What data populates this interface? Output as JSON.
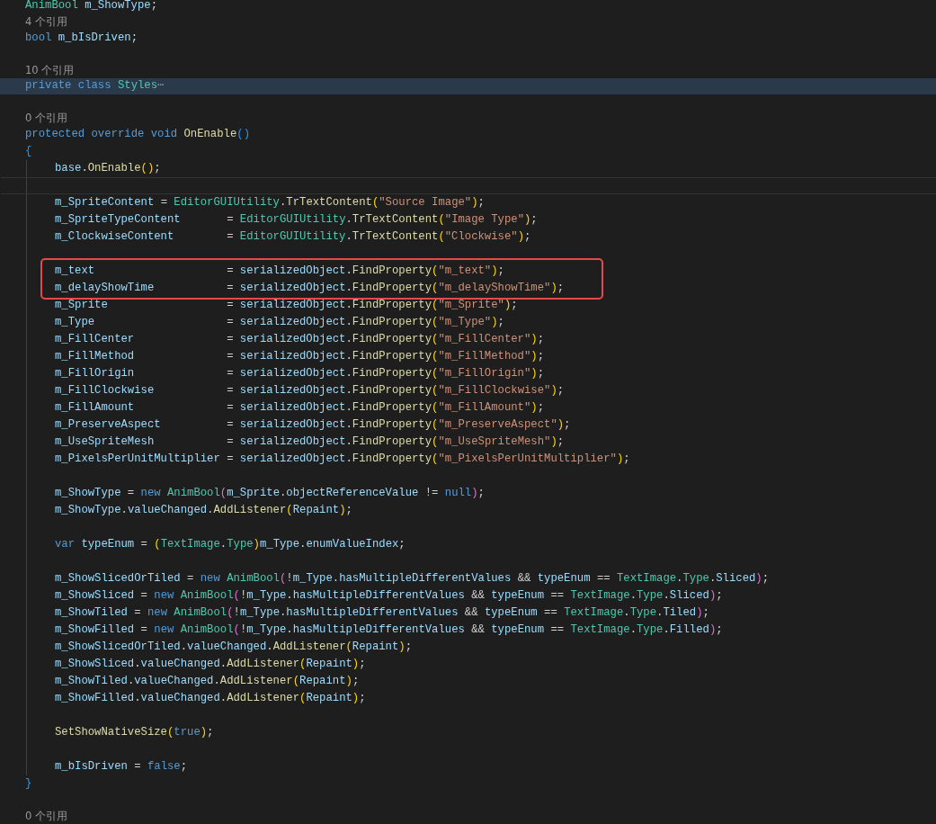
{
  "lines": [
    {
      "kind": "code",
      "selected": false,
      "tokens": [
        {
          "kind": "type",
          "text": "AnimBool"
        },
        {
          "kind": "var",
          "text": " m_ShowType"
        },
        {
          "kind": "op",
          "text": ";"
        }
      ]
    },
    {
      "kind": "lens",
      "selected": false,
      "text": "4 个引用"
    },
    {
      "kind": "code",
      "selected": false,
      "tokens": [
        {
          "kind": "kw",
          "text": "bool"
        },
        {
          "kind": "var",
          "text": " m_bIsDriven"
        },
        {
          "kind": "op",
          "text": ";"
        }
      ]
    },
    {
      "kind": "blank",
      "selected": false
    },
    {
      "kind": "lens",
      "selected": false,
      "text": "10 个引用"
    },
    {
      "kind": "code",
      "selected": true,
      "tokens": [
        {
          "kind": "kw",
          "text": "private"
        },
        {
          "kind": "kw",
          "text": " class"
        },
        {
          "kind": "type",
          "text": " Styles"
        },
        {
          "kind": "fold",
          "text": "⋯"
        }
      ]
    },
    {
      "kind": "blank",
      "selected": false
    },
    {
      "kind": "lens",
      "selected": false,
      "text": "0 个引用"
    },
    {
      "kind": "code",
      "selected": false,
      "tokens": [
        {
          "kind": "kw",
          "text": "protected"
        },
        {
          "kind": "kw",
          "text": " override"
        },
        {
          "kind": "kw",
          "text": " void"
        },
        {
          "kind": "fn",
          "text": " OnEnable"
        },
        {
          "kind": "p3",
          "text": "()"
        }
      ]
    },
    {
      "kind": "block",
      "selected": false,
      "open": [
        {
          "kind": "p3",
          "text": "{"
        }
      ],
      "close": [
        {
          "kind": "p3",
          "text": "}"
        }
      ],
      "children": [
        {
          "kind": "code",
          "tokens": [
            {
              "kind": "var",
              "text": "base"
            },
            {
              "kind": "op",
              "text": "."
            },
            {
              "kind": "fn",
              "text": "OnEnable"
            },
            {
              "kind": "p1",
              "text": "()"
            },
            {
              "kind": "op",
              "text": ";"
            }
          ]
        },
        {
          "kind": "cursor"
        },
        {
          "kind": "code",
          "tokens": [
            {
              "kind": "var",
              "text": "m_SpriteContent"
            },
            {
              "kind": "op",
              "text": " = "
            },
            {
              "kind": "type",
              "text": "EditorGUIUtility"
            },
            {
              "kind": "op",
              "text": "."
            },
            {
              "kind": "fn",
              "text": "TrTextContent"
            },
            {
              "kind": "p1",
              "text": "("
            },
            {
              "kind": "str",
              "text": "\"Source Image\""
            },
            {
              "kind": "p1",
              "text": ")"
            },
            {
              "kind": "op",
              "text": ";"
            }
          ]
        },
        {
          "kind": "code",
          "tokens": [
            {
              "kind": "var",
              "text": "m_SpriteTypeContent"
            },
            {
              "kind": "op",
              "text": "       = "
            },
            {
              "kind": "type",
              "text": "EditorGUIUtility"
            },
            {
              "kind": "op",
              "text": "."
            },
            {
              "kind": "fn",
              "text": "TrTextContent"
            },
            {
              "kind": "p1",
              "text": "("
            },
            {
              "kind": "str",
              "text": "\"Image Type\""
            },
            {
              "kind": "p1",
              "text": ")"
            },
            {
              "kind": "op",
              "text": ";"
            }
          ]
        },
        {
          "kind": "code",
          "tokens": [
            {
              "kind": "var",
              "text": "m_ClockwiseContent"
            },
            {
              "kind": "op",
              "text": "        = "
            },
            {
              "kind": "type",
              "text": "EditorGUIUtility"
            },
            {
              "kind": "op",
              "text": "."
            },
            {
              "kind": "fn",
              "text": "TrTextContent"
            },
            {
              "kind": "p1",
              "text": "("
            },
            {
              "kind": "str",
              "text": "\"Clockwise\""
            },
            {
              "kind": "p1",
              "text": ")"
            },
            {
              "kind": "op",
              "text": ";"
            }
          ]
        },
        {
          "kind": "blank"
        },
        {
          "kind": "boxed",
          "children": [
            {
              "kind": "code",
              "tokens": [
                {
                  "kind": "var",
                  "text": "m_text"
                },
                {
                  "kind": "op",
                  "text": "                    = "
                },
                {
                  "kind": "var",
                  "text": "serializedObject"
                },
                {
                  "kind": "op",
                  "text": "."
                },
                {
                  "kind": "fn",
                  "text": "FindProperty"
                },
                {
                  "kind": "p1",
                  "text": "("
                },
                {
                  "kind": "str",
                  "text": "\"m_text\""
                },
                {
                  "kind": "p1",
                  "text": ")"
                },
                {
                  "kind": "op",
                  "text": ";"
                }
              ]
            },
            {
              "kind": "code",
              "tokens": [
                {
                  "kind": "var",
                  "text": "m_delayShowTime"
                },
                {
                  "kind": "op",
                  "text": "           = "
                },
                {
                  "kind": "var",
                  "text": "serializedObject"
                },
                {
                  "kind": "op",
                  "text": "."
                },
                {
                  "kind": "fn",
                  "text": "FindProperty"
                },
                {
                  "kind": "p1",
                  "text": "("
                },
                {
                  "kind": "str",
                  "text": "\"m_delayShowTime\""
                },
                {
                  "kind": "p1",
                  "text": ")"
                },
                {
                  "kind": "op",
                  "text": ";"
                }
              ]
            }
          ]
        },
        {
          "kind": "code",
          "tokens": [
            {
              "kind": "var",
              "text": "m_Sprite"
            },
            {
              "kind": "op",
              "text": "                  = "
            },
            {
              "kind": "var",
              "text": "serializedObject"
            },
            {
              "kind": "op",
              "text": "."
            },
            {
              "kind": "fn",
              "text": "FindProperty"
            },
            {
              "kind": "p1",
              "text": "("
            },
            {
              "kind": "str",
              "text": "\"m_Sprite\""
            },
            {
              "kind": "p1",
              "text": ")"
            },
            {
              "kind": "op",
              "text": ";"
            }
          ]
        },
        {
          "kind": "code",
          "tokens": [
            {
              "kind": "var",
              "text": "m_Type"
            },
            {
              "kind": "op",
              "text": "                    = "
            },
            {
              "kind": "var",
              "text": "serializedObject"
            },
            {
              "kind": "op",
              "text": "."
            },
            {
              "kind": "fn",
              "text": "FindProperty"
            },
            {
              "kind": "p1",
              "text": "("
            },
            {
              "kind": "str",
              "text": "\"m_Type\""
            },
            {
              "kind": "p1",
              "text": ")"
            },
            {
              "kind": "op",
              "text": ";"
            }
          ]
        },
        {
          "kind": "code",
          "tokens": [
            {
              "kind": "var",
              "text": "m_FillCenter"
            },
            {
              "kind": "op",
              "text": "              = "
            },
            {
              "kind": "var",
              "text": "serializedObject"
            },
            {
              "kind": "op",
              "text": "."
            },
            {
              "kind": "fn",
              "text": "FindProperty"
            },
            {
              "kind": "p1",
              "text": "("
            },
            {
              "kind": "str",
              "text": "\"m_FillCenter\""
            },
            {
              "kind": "p1",
              "text": ")"
            },
            {
              "kind": "op",
              "text": ";"
            }
          ]
        },
        {
          "kind": "code",
          "tokens": [
            {
              "kind": "var",
              "text": "m_FillMethod"
            },
            {
              "kind": "op",
              "text": "              = "
            },
            {
              "kind": "var",
              "text": "serializedObject"
            },
            {
              "kind": "op",
              "text": "."
            },
            {
              "kind": "fn",
              "text": "FindProperty"
            },
            {
              "kind": "p1",
              "text": "("
            },
            {
              "kind": "str",
              "text": "\"m_FillMethod\""
            },
            {
              "kind": "p1",
              "text": ")"
            },
            {
              "kind": "op",
              "text": ";"
            }
          ]
        },
        {
          "kind": "code",
          "tokens": [
            {
              "kind": "var",
              "text": "m_FillOrigin"
            },
            {
              "kind": "op",
              "text": "              = "
            },
            {
              "kind": "var",
              "text": "serializedObject"
            },
            {
              "kind": "op",
              "text": "."
            },
            {
              "kind": "fn",
              "text": "FindProperty"
            },
            {
              "kind": "p1",
              "text": "("
            },
            {
              "kind": "str",
              "text": "\"m_FillOrigin\""
            },
            {
              "kind": "p1",
              "text": ")"
            },
            {
              "kind": "op",
              "text": ";"
            }
          ]
        },
        {
          "kind": "code",
          "tokens": [
            {
              "kind": "var",
              "text": "m_FillClockwise"
            },
            {
              "kind": "op",
              "text": "           = "
            },
            {
              "kind": "var",
              "text": "serializedObject"
            },
            {
              "kind": "op",
              "text": "."
            },
            {
              "kind": "fn",
              "text": "FindProperty"
            },
            {
              "kind": "p1",
              "text": "("
            },
            {
              "kind": "str",
              "text": "\"m_FillClockwise\""
            },
            {
              "kind": "p1",
              "text": ")"
            },
            {
              "kind": "op",
              "text": ";"
            }
          ]
        },
        {
          "kind": "code",
          "tokens": [
            {
              "kind": "var",
              "text": "m_FillAmount"
            },
            {
              "kind": "op",
              "text": "              = "
            },
            {
              "kind": "var",
              "text": "serializedObject"
            },
            {
              "kind": "op",
              "text": "."
            },
            {
              "kind": "fn",
              "text": "FindProperty"
            },
            {
              "kind": "p1",
              "text": "("
            },
            {
              "kind": "str",
              "text": "\"m_FillAmount\""
            },
            {
              "kind": "p1",
              "text": ")"
            },
            {
              "kind": "op",
              "text": ";"
            }
          ]
        },
        {
          "kind": "code",
          "tokens": [
            {
              "kind": "var",
              "text": "m_PreserveAspect"
            },
            {
              "kind": "op",
              "text": "          = "
            },
            {
              "kind": "var",
              "text": "serializedObject"
            },
            {
              "kind": "op",
              "text": "."
            },
            {
              "kind": "fn",
              "text": "FindProperty"
            },
            {
              "kind": "p1",
              "text": "("
            },
            {
              "kind": "str",
              "text": "\"m_PreserveAspect\""
            },
            {
              "kind": "p1",
              "text": ")"
            },
            {
              "kind": "op",
              "text": ";"
            }
          ]
        },
        {
          "kind": "code",
          "tokens": [
            {
              "kind": "var",
              "text": "m_UseSpriteMesh"
            },
            {
              "kind": "op",
              "text": "           = "
            },
            {
              "kind": "var",
              "text": "serializedObject"
            },
            {
              "kind": "op",
              "text": "."
            },
            {
              "kind": "fn",
              "text": "FindProperty"
            },
            {
              "kind": "p1",
              "text": "("
            },
            {
              "kind": "str",
              "text": "\"m_UseSpriteMesh\""
            },
            {
              "kind": "p1",
              "text": ")"
            },
            {
              "kind": "op",
              "text": ";"
            }
          ]
        },
        {
          "kind": "code",
          "tokens": [
            {
              "kind": "var",
              "text": "m_PixelsPerUnitMultiplier"
            },
            {
              "kind": "op",
              "text": " = "
            },
            {
              "kind": "var",
              "text": "serializedObject"
            },
            {
              "kind": "op",
              "text": "."
            },
            {
              "kind": "fn",
              "text": "FindProperty"
            },
            {
              "kind": "p1",
              "text": "("
            },
            {
              "kind": "str",
              "text": "\"m_PixelsPerUnitMultiplier\""
            },
            {
              "kind": "p1",
              "text": ")"
            },
            {
              "kind": "op",
              "text": ";"
            }
          ]
        },
        {
          "kind": "blank"
        },
        {
          "kind": "code",
          "tokens": [
            {
              "kind": "var",
              "text": "m_ShowType"
            },
            {
              "kind": "op",
              "text": " = "
            },
            {
              "kind": "kw",
              "text": "new"
            },
            {
              "kind": "type",
              "text": " AnimBool"
            },
            {
              "kind": "p2",
              "text": "("
            },
            {
              "kind": "var",
              "text": "m_Sprite"
            },
            {
              "kind": "op",
              "text": "."
            },
            {
              "kind": "var",
              "text": "objectReferenceValue"
            },
            {
              "kind": "op",
              "text": " != "
            },
            {
              "kind": "kw",
              "text": "null"
            },
            {
              "kind": "p2",
              "text": ")"
            },
            {
              "kind": "op",
              "text": ";"
            }
          ]
        },
        {
          "kind": "code",
          "tokens": [
            {
              "kind": "var",
              "text": "m_ShowType"
            },
            {
              "kind": "op",
              "text": "."
            },
            {
              "kind": "var",
              "text": "valueChanged"
            },
            {
              "kind": "op",
              "text": "."
            },
            {
              "kind": "fn",
              "text": "AddListener"
            },
            {
              "kind": "p1",
              "text": "("
            },
            {
              "kind": "var",
              "text": "Repaint"
            },
            {
              "kind": "p1",
              "text": ")"
            },
            {
              "kind": "op",
              "text": ";"
            }
          ]
        },
        {
          "kind": "blank"
        },
        {
          "kind": "code",
          "tokens": [
            {
              "kind": "kw",
              "text": "var"
            },
            {
              "kind": "var",
              "text": " typeEnum"
            },
            {
              "kind": "op",
              "text": " = "
            },
            {
              "kind": "p1",
              "text": "("
            },
            {
              "kind": "type",
              "text": "TextImage"
            },
            {
              "kind": "op",
              "text": "."
            },
            {
              "kind": "type",
              "text": "Type"
            },
            {
              "kind": "p1",
              "text": ")"
            },
            {
              "kind": "var",
              "text": "m_Type"
            },
            {
              "kind": "op",
              "text": "."
            },
            {
              "kind": "var",
              "text": "enumValueIndex"
            },
            {
              "kind": "op",
              "text": ";"
            }
          ]
        },
        {
          "kind": "blank"
        },
        {
          "kind": "code",
          "tokens": [
            {
              "kind": "var",
              "text": "m_ShowSlicedOrTiled"
            },
            {
              "kind": "op",
              "text": " = "
            },
            {
              "kind": "kw",
              "text": "new"
            },
            {
              "kind": "type",
              "text": " AnimBool"
            },
            {
              "kind": "p2",
              "text": "("
            },
            {
              "kind": "op",
              "text": "!"
            },
            {
              "kind": "var",
              "text": "m_Type"
            },
            {
              "kind": "op",
              "text": "."
            },
            {
              "kind": "var",
              "text": "hasMultipleDifferentValues"
            },
            {
              "kind": "op",
              "text": " && "
            },
            {
              "kind": "var",
              "text": "typeEnum"
            },
            {
              "kind": "op",
              "text": " == "
            },
            {
              "kind": "type",
              "text": "TextImage"
            },
            {
              "kind": "op",
              "text": "."
            },
            {
              "kind": "type",
              "text": "Type"
            },
            {
              "kind": "op",
              "text": "."
            },
            {
              "kind": "var",
              "text": "Sliced"
            },
            {
              "kind": "p2",
              "text": ")"
            },
            {
              "kind": "op",
              "text": ";"
            }
          ]
        },
        {
          "kind": "code",
          "tokens": [
            {
              "kind": "var",
              "text": "m_ShowSliced"
            },
            {
              "kind": "op",
              "text": " = "
            },
            {
              "kind": "kw",
              "text": "new"
            },
            {
              "kind": "type",
              "text": " AnimBool"
            },
            {
              "kind": "p2",
              "text": "("
            },
            {
              "kind": "op",
              "text": "!"
            },
            {
              "kind": "var",
              "text": "m_Type"
            },
            {
              "kind": "op",
              "text": "."
            },
            {
              "kind": "var",
              "text": "hasMultipleDifferentValues"
            },
            {
              "kind": "op",
              "text": " && "
            },
            {
              "kind": "var",
              "text": "typeEnum"
            },
            {
              "kind": "op",
              "text": " == "
            },
            {
              "kind": "type",
              "text": "TextImage"
            },
            {
              "kind": "op",
              "text": "."
            },
            {
              "kind": "type",
              "text": "Type"
            },
            {
              "kind": "op",
              "text": "."
            },
            {
              "kind": "var",
              "text": "Sliced"
            },
            {
              "kind": "p2",
              "text": ")"
            },
            {
              "kind": "op",
              "text": ";"
            }
          ]
        },
        {
          "kind": "code",
          "tokens": [
            {
              "kind": "var",
              "text": "m_ShowTiled"
            },
            {
              "kind": "op",
              "text": " = "
            },
            {
              "kind": "kw",
              "text": "new"
            },
            {
              "kind": "type",
              "text": " AnimBool"
            },
            {
              "kind": "p2",
              "text": "("
            },
            {
              "kind": "op",
              "text": "!"
            },
            {
              "kind": "var",
              "text": "m_Type"
            },
            {
              "kind": "op",
              "text": "."
            },
            {
              "kind": "var",
              "text": "hasMultipleDifferentValues"
            },
            {
              "kind": "op",
              "text": " && "
            },
            {
              "kind": "var",
              "text": "typeEnum"
            },
            {
              "kind": "op",
              "text": " == "
            },
            {
              "kind": "type",
              "text": "TextImage"
            },
            {
              "kind": "op",
              "text": "."
            },
            {
              "kind": "type",
              "text": "Type"
            },
            {
              "kind": "op",
              "text": "."
            },
            {
              "kind": "var",
              "text": "Tiled"
            },
            {
              "kind": "p2",
              "text": ")"
            },
            {
              "kind": "op",
              "text": ";"
            }
          ]
        },
        {
          "kind": "code",
          "tokens": [
            {
              "kind": "var",
              "text": "m_ShowFilled"
            },
            {
              "kind": "op",
              "text": " = "
            },
            {
              "kind": "kw",
              "text": "new"
            },
            {
              "kind": "type",
              "text": " AnimBool"
            },
            {
              "kind": "p2",
              "text": "("
            },
            {
              "kind": "op",
              "text": "!"
            },
            {
              "kind": "var",
              "text": "m_Type"
            },
            {
              "kind": "op",
              "text": "."
            },
            {
              "kind": "var",
              "text": "hasMultipleDifferentValues"
            },
            {
              "kind": "op",
              "text": " && "
            },
            {
              "kind": "var",
              "text": "typeEnum"
            },
            {
              "kind": "op",
              "text": " == "
            },
            {
              "kind": "type",
              "text": "TextImage"
            },
            {
              "kind": "op",
              "text": "."
            },
            {
              "kind": "type",
              "text": "Type"
            },
            {
              "kind": "op",
              "text": "."
            },
            {
              "kind": "var",
              "text": "Filled"
            },
            {
              "kind": "p2",
              "text": ")"
            },
            {
              "kind": "op",
              "text": ";"
            }
          ]
        },
        {
          "kind": "code",
          "tokens": [
            {
              "kind": "var",
              "text": "m_ShowSlicedOrTiled"
            },
            {
              "kind": "op",
              "text": "."
            },
            {
              "kind": "var",
              "text": "valueChanged"
            },
            {
              "kind": "op",
              "text": "."
            },
            {
              "kind": "fn",
              "text": "AddListener"
            },
            {
              "kind": "p1",
              "text": "("
            },
            {
              "kind": "var",
              "text": "Repaint"
            },
            {
              "kind": "p1",
              "text": ")"
            },
            {
              "kind": "op",
              "text": ";"
            }
          ]
        },
        {
          "kind": "code",
          "tokens": [
            {
              "kind": "var",
              "text": "m_ShowSliced"
            },
            {
              "kind": "op",
              "text": "."
            },
            {
              "kind": "var",
              "text": "valueChanged"
            },
            {
              "kind": "op",
              "text": "."
            },
            {
              "kind": "fn",
              "text": "AddListener"
            },
            {
              "kind": "p1",
              "text": "("
            },
            {
              "kind": "var",
              "text": "Repaint"
            },
            {
              "kind": "p1",
              "text": ")"
            },
            {
              "kind": "op",
              "text": ";"
            }
          ]
        },
        {
          "kind": "code",
          "tokens": [
            {
              "kind": "var",
              "text": "m_ShowTiled"
            },
            {
              "kind": "op",
              "text": "."
            },
            {
              "kind": "var",
              "text": "valueChanged"
            },
            {
              "kind": "op",
              "text": "."
            },
            {
              "kind": "fn",
              "text": "AddListener"
            },
            {
              "kind": "p1",
              "text": "("
            },
            {
              "kind": "var",
              "text": "Repaint"
            },
            {
              "kind": "p1",
              "text": ")"
            },
            {
              "kind": "op",
              "text": ";"
            }
          ]
        },
        {
          "kind": "code",
          "tokens": [
            {
              "kind": "var",
              "text": "m_ShowFilled"
            },
            {
              "kind": "op",
              "text": "."
            },
            {
              "kind": "var",
              "text": "valueChanged"
            },
            {
              "kind": "op",
              "text": "."
            },
            {
              "kind": "fn",
              "text": "AddListener"
            },
            {
              "kind": "p1",
              "text": "("
            },
            {
              "kind": "var",
              "text": "Repaint"
            },
            {
              "kind": "p1",
              "text": ")"
            },
            {
              "kind": "op",
              "text": ";"
            }
          ]
        },
        {
          "kind": "blank"
        },
        {
          "kind": "code",
          "tokens": [
            {
              "kind": "fn",
              "text": "SetShowNativeSize"
            },
            {
              "kind": "p1",
              "text": "("
            },
            {
              "kind": "kw",
              "text": "true"
            },
            {
              "kind": "p1",
              "text": ")"
            },
            {
              "kind": "op",
              "text": ";"
            }
          ]
        },
        {
          "kind": "blank"
        },
        {
          "kind": "code",
          "tokens": [
            {
              "kind": "var",
              "text": "m_bIsDriven"
            },
            {
              "kind": "op",
              "text": " = "
            },
            {
              "kind": "kw",
              "text": "false"
            },
            {
              "kind": "op",
              "text": ";"
            }
          ]
        }
      ]
    },
    {
      "kind": "blank",
      "selected": false
    },
    {
      "kind": "lens",
      "selected": false,
      "text": "0 个引用"
    }
  ]
}
